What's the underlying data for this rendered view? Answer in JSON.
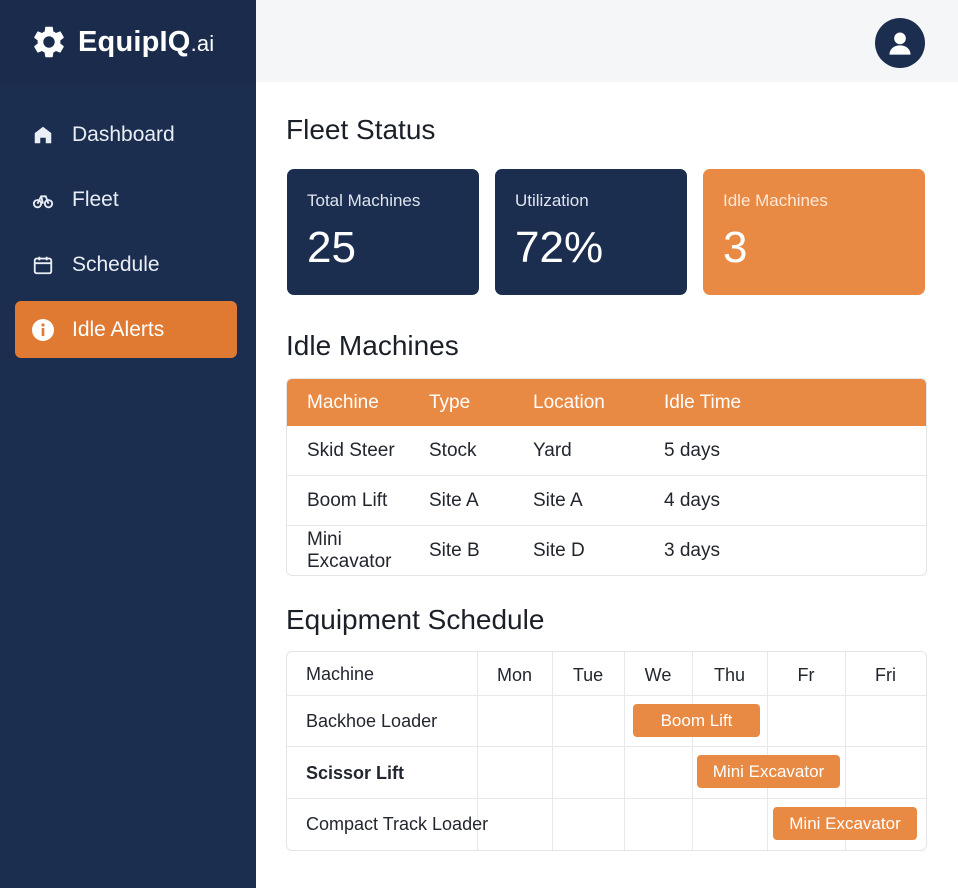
{
  "app": {
    "brand_name": "EquipIQ",
    "brand_tld": ".ai"
  },
  "sidebar": {
    "items": [
      {
        "label": "Dashboard",
        "icon": "home-icon",
        "active": false
      },
      {
        "label": "Fleet",
        "icon": "fleet-icon",
        "active": false
      },
      {
        "label": "Schedule",
        "icon": "calendar-icon",
        "active": false
      },
      {
        "label": "Idle Alerts",
        "icon": "info-icon",
        "active": true
      }
    ]
  },
  "header": {
    "avatar_icon": "user-avatar-icon"
  },
  "fleet_status": {
    "title": "Fleet Status",
    "cards": [
      {
        "label": "Total Machines",
        "value": "25",
        "color": "#1c2e4f"
      },
      {
        "label": "Utilization",
        "value": "72%",
        "color": "#1c2e4f"
      },
      {
        "label": "Idle Machines",
        "value": "3",
        "color": "#e98a44"
      }
    ]
  },
  "idle_machines": {
    "title": "Idle Machines",
    "columns": [
      "Machine",
      "Type",
      "Location",
      "Idle Time"
    ],
    "rows": [
      [
        "Skid Steer",
        "Stock",
        "Yard",
        "5 days"
      ],
      [
        "Boom Lift",
        "Site A",
        "Site A",
        "4 days"
      ],
      [
        "Mini Excavator",
        "Site B",
        "Site D",
        "3 days"
      ]
    ]
  },
  "schedule": {
    "title": "Equipment Schedule",
    "columns": [
      "Machine",
      "Mon",
      "Tue",
      "We",
      "Thu",
      "Fr",
      "Fri"
    ],
    "rows": [
      {
        "machine": "Backhoe Loader",
        "booking": "Boom Lift"
      },
      {
        "machine": "Scissor Lift",
        "booking": "Mini Excavator"
      },
      {
        "machine": "Compact Track Loader",
        "booking": "Mini Excavator"
      }
    ]
  },
  "colors": {
    "navy": "#1c2e4f",
    "accent": "#e98a44",
    "active_nav": "#e07a33"
  }
}
